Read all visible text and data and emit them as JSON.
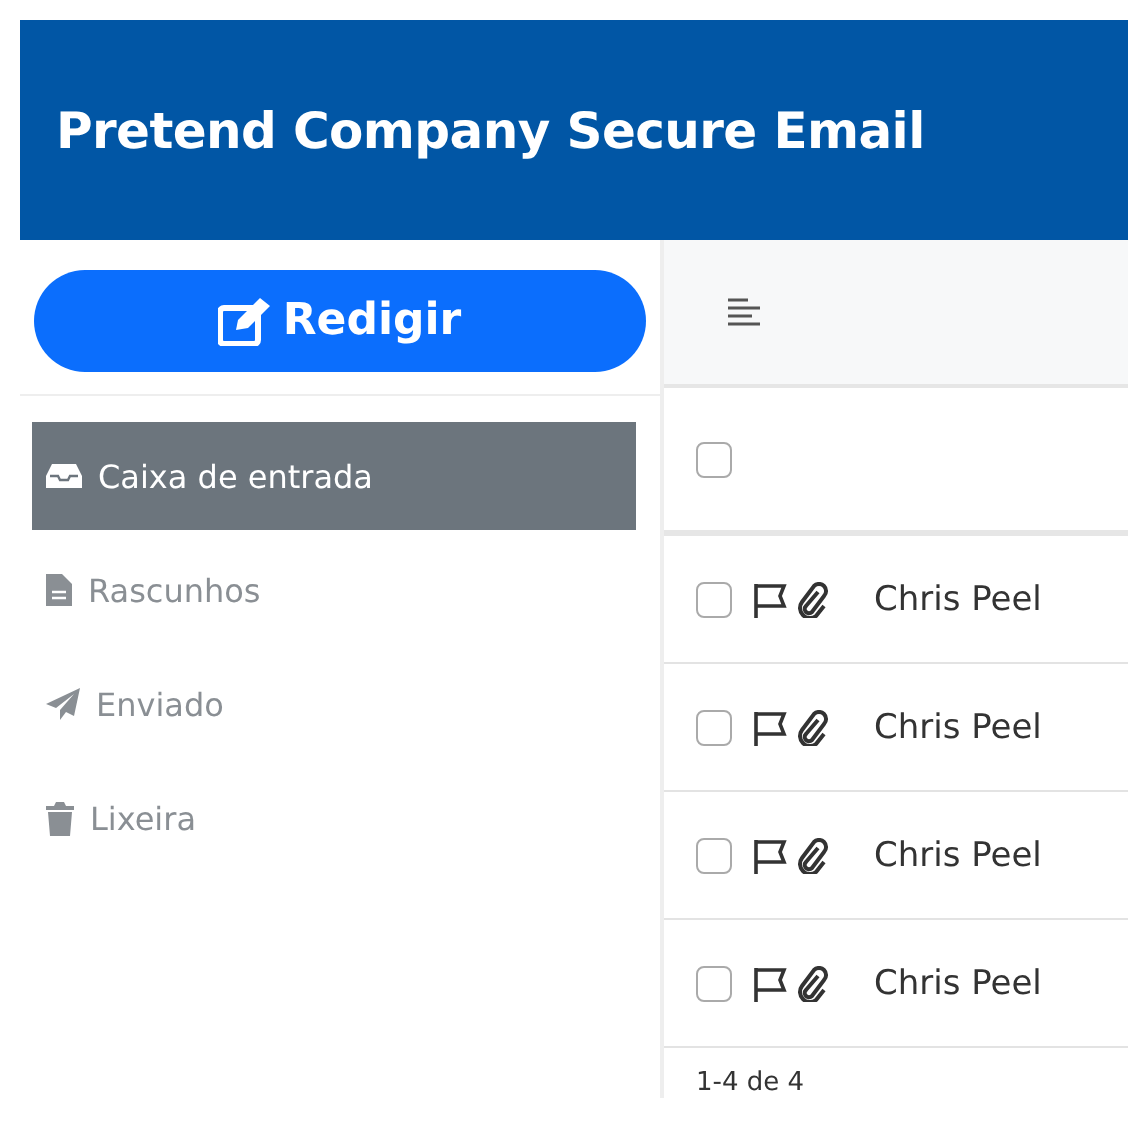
{
  "header": {
    "title": "Pretend Company Secure Email"
  },
  "compose": {
    "label": "Redigir"
  },
  "folders": [
    {
      "label": "Caixa de entrada",
      "kind": "inbox",
      "selected": true
    },
    {
      "label": "Rascunhos",
      "kind": "drafts",
      "selected": false
    },
    {
      "label": "Enviado",
      "kind": "sent",
      "selected": false
    },
    {
      "label": "Lixeira",
      "kind": "trash",
      "selected": false
    }
  ],
  "list": {
    "select_all": {
      "checked": false
    },
    "rows": [
      {
        "sender": "Chris Peel",
        "checked": false,
        "flagged": false,
        "attachment": true
      },
      {
        "sender": "Chris Peel",
        "checked": false,
        "flagged": false,
        "attachment": true
      },
      {
        "sender": "Chris Peel",
        "checked": false,
        "flagged": false,
        "attachment": true
      },
      {
        "sender": "Chris Peel",
        "checked": false,
        "flagged": false,
        "attachment": true
      }
    ],
    "pagination": "1-4 de 4"
  }
}
